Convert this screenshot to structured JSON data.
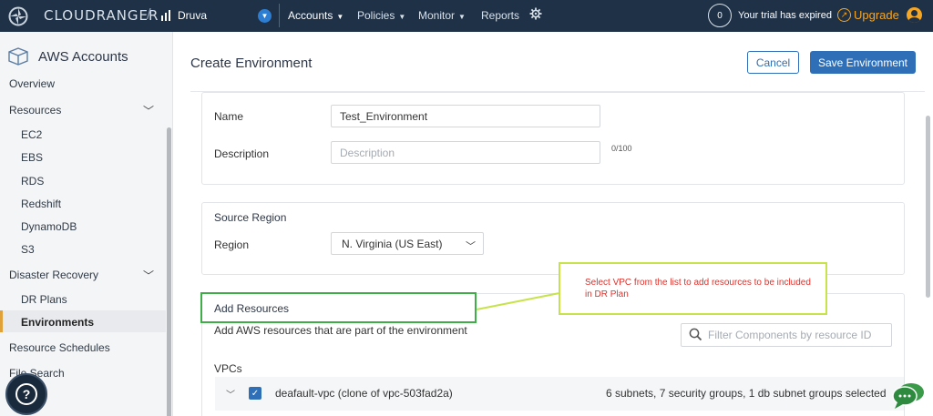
{
  "topbar": {
    "brand": "CLOUDRANGER",
    "separator": "/",
    "product": "Druva",
    "nav": [
      {
        "label": "Accounts"
      },
      {
        "label": "Policies"
      },
      {
        "label": "Monitor"
      },
      {
        "label": "Reports"
      }
    ],
    "trial_count": "0",
    "trial_text": "Your trial has expired",
    "upgrade_label": "Upgrade"
  },
  "sidebar": {
    "title": "AWS Accounts",
    "items": [
      {
        "label": "Overview"
      },
      {
        "label": "Resources"
      },
      {
        "label": "EC2"
      },
      {
        "label": "EBS"
      },
      {
        "label": "RDS"
      },
      {
        "label": "Redshift"
      },
      {
        "label": "DynamoDB"
      },
      {
        "label": "S3"
      },
      {
        "label": "Disaster Recovery"
      },
      {
        "label": "DR Plans"
      },
      {
        "label": "Environments"
      },
      {
        "label": "Resource Schedules"
      },
      {
        "label": "File Search"
      }
    ]
  },
  "page": {
    "title": "Create Environment",
    "cancel_label": "Cancel",
    "save_label": "Save Environment"
  },
  "form": {
    "name_label": "Name",
    "name_value": "Test_Environment",
    "description_label": "Description",
    "description_placeholder": "Description",
    "description_counter": "0/100"
  },
  "source_region": {
    "title": "Source Region",
    "region_label": "Region",
    "region_value": "N. Virginia (US East)"
  },
  "add_resources": {
    "title": "Add Resources",
    "subtitle": "Add AWS resources that are part of the environment",
    "search_placeholder": "Filter Components by resource ID",
    "vpcs_label": "VPCs",
    "vpc": {
      "name": "deafault-vpc (clone of vpc-503fad2a)",
      "meta": "6 subnets, 7 security groups, 1 db subnet groups selected"
    }
  },
  "callout": {
    "text": "Select VPC from the list to add resources to be included in DR Plan"
  },
  "colors": {
    "nav_bg": "#1f3147",
    "primary": "#2e6fb8",
    "upgrade": "#f5a623",
    "annotation_green": "#3fae49",
    "callout_border": "#c6e34b",
    "callout_text": "#e0312b"
  }
}
